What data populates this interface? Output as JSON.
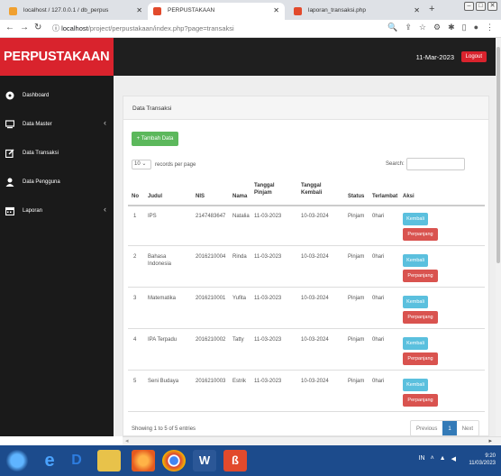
{
  "browser": {
    "tabs": [
      {
        "title": "localhost / 127.0.0.1 / db_perpus"
      },
      {
        "title": "PERPUSTAKAAN"
      },
      {
        "title": "laporan_transaksi.php"
      }
    ],
    "new_tab": "+",
    "url_host": "localhost",
    "url_path": "/project/perpustakaan/index.php?page=transaksi"
  },
  "header": {
    "brand": "PERPUSTAKAAN",
    "date": "11-Mar-2023",
    "logout": "Logout"
  },
  "sidebar": {
    "items": [
      {
        "label": "Dashboard",
        "icon": "dashboard-icon"
      },
      {
        "label": "Data Master",
        "icon": "monitor-icon"
      },
      {
        "label": "Data Transaksi",
        "icon": "edit-icon"
      },
      {
        "label": "Data Pengguna",
        "icon": "user-icon"
      },
      {
        "label": "Laporan",
        "icon": "calendar-icon"
      }
    ]
  },
  "main": {
    "panel_title": "Data Transaksi",
    "add_button": "+ Tambah Data",
    "records_value": "10",
    "records_label": "records per page",
    "search_label": "Search:",
    "columns": [
      "No",
      "Judul",
      "NIS",
      "Nama",
      "Tanggal Pinjam",
      "Tanggal Kembali",
      "Status",
      "Terlambat",
      "Aksi"
    ],
    "rows": [
      {
        "no": "1",
        "judul": "IPS",
        "nis": "2147483647",
        "nama": "Natalia",
        "pinjam": "11-03-2023",
        "kembali": "10-03-2024",
        "status": "Pinjam",
        "terlambat": "0hari"
      },
      {
        "no": "2",
        "judul": "Bahasa Indonesia",
        "nis": "2016210004",
        "nama": "Rinda",
        "pinjam": "11-03-2023",
        "kembali": "10-03-2024",
        "status": "Pinjam",
        "terlambat": "0hari"
      },
      {
        "no": "3",
        "judul": "Matematika",
        "nis": "2016210001",
        "nama": "Yufita",
        "pinjam": "11-03-2023",
        "kembali": "10-03-2024",
        "status": "Pinjam",
        "terlambat": "0hari"
      },
      {
        "no": "4",
        "judul": "IPA Terpadu",
        "nis": "2016210002",
        "nama": "Tatty",
        "pinjam": "11-03-2023",
        "kembali": "10-03-2024",
        "status": "Pinjam",
        "terlambat": "0hari"
      },
      {
        "no": "5",
        "judul": "Seni Budaya",
        "nis": "2016210003",
        "nama": "Estrik",
        "pinjam": "11-03-2023",
        "kembali": "10-03-2024",
        "status": "Pinjam",
        "terlambat": "0hari"
      }
    ],
    "btn_kembali": "Kembali",
    "btn_perpanjang": "Perpanjang",
    "footer_info": "Showing 1 to 5 of 5 entries",
    "pager": {
      "prev": "Previous",
      "current": "1",
      "next": "Next"
    }
  },
  "taskbar": {
    "time": "9:20",
    "date": "11/03/2023",
    "lang": "IN"
  },
  "colors": {
    "brand_red": "#d9232d",
    "success": "#5cb85c",
    "info": "#5bc0de",
    "danger": "#d9534f",
    "primary": "#337ab7"
  }
}
